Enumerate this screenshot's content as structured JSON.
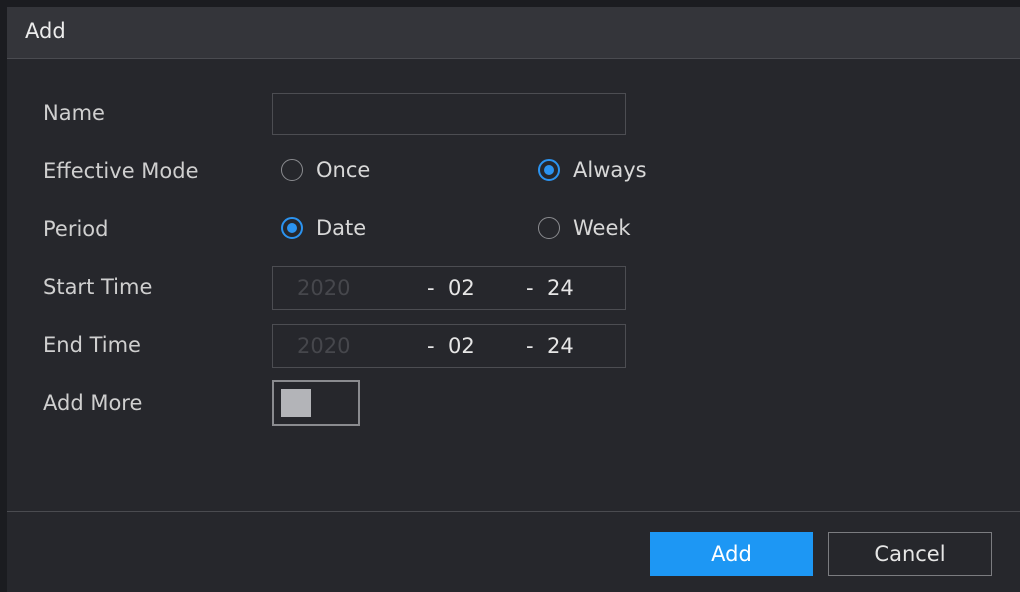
{
  "dialog": {
    "title": "Add",
    "fields": {
      "name": {
        "label": "Name",
        "value": "",
        "placeholder": ""
      },
      "effective_mode": {
        "label": "Effective Mode",
        "options": [
          {
            "label": "Once",
            "checked": false
          },
          {
            "label": "Always",
            "checked": true
          }
        ]
      },
      "period": {
        "label": "Period",
        "options": [
          {
            "label": "Date",
            "checked": true
          },
          {
            "label": "Week",
            "checked": false
          }
        ]
      },
      "start_time": {
        "label": "Start Time",
        "year": "2020",
        "sep": "-",
        "month": "02",
        "day": "24"
      },
      "end_time": {
        "label": "End Time",
        "year": "2020",
        "sep": "-",
        "month": "02",
        "day": "24"
      },
      "add_more": {
        "label": "Add More",
        "enabled": false
      }
    },
    "buttons": {
      "add": "Add",
      "cancel": "Cancel"
    }
  },
  "colors": {
    "accent": "#1d97f4",
    "radio_checked": "#2b93f0",
    "background": "#26272c",
    "titlebar": "#34353a"
  }
}
